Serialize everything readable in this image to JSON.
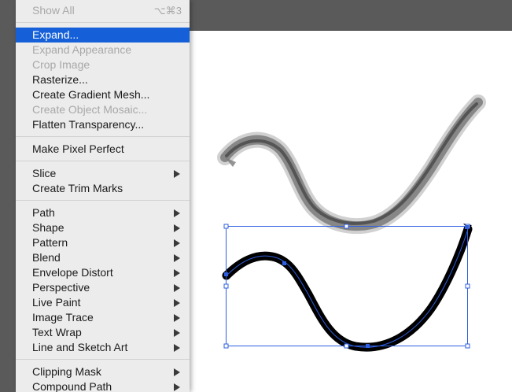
{
  "menu": {
    "items": [
      {
        "id": "show-all",
        "label": "Show All",
        "shortcut": "⌥⌘3",
        "state": "disabled",
        "submenu": false
      },
      {
        "id": "expand",
        "label": "Expand...",
        "state": "highlighted",
        "submenu": false
      },
      {
        "id": "expand-appearance",
        "label": "Expand Appearance",
        "state": "disabled",
        "submenu": false
      },
      {
        "id": "crop-image",
        "label": "Crop Image",
        "state": "disabled",
        "submenu": false
      },
      {
        "id": "rasterize",
        "label": "Rasterize...",
        "state": "enabled",
        "submenu": false
      },
      {
        "id": "create-gradient-mesh",
        "label": "Create Gradient Mesh...",
        "state": "enabled",
        "submenu": false
      },
      {
        "id": "create-object-mosaic",
        "label": "Create Object Mosaic...",
        "state": "disabled",
        "submenu": false
      },
      {
        "id": "flatten-transparency",
        "label": "Flatten Transparency...",
        "state": "enabled",
        "submenu": false
      },
      {
        "id": "make-pixel-perfect",
        "label": "Make Pixel Perfect",
        "state": "enabled",
        "submenu": false
      },
      {
        "id": "slice",
        "label": "Slice",
        "state": "enabled",
        "submenu": true
      },
      {
        "id": "create-trim-marks",
        "label": "Create Trim Marks",
        "state": "enabled",
        "submenu": false
      },
      {
        "id": "path",
        "label": "Path",
        "state": "enabled",
        "submenu": true
      },
      {
        "id": "shape",
        "label": "Shape",
        "state": "enabled",
        "submenu": true
      },
      {
        "id": "pattern",
        "label": "Pattern",
        "state": "enabled",
        "submenu": true
      },
      {
        "id": "blend",
        "label": "Blend",
        "state": "enabled",
        "submenu": true
      },
      {
        "id": "envelope-distort",
        "label": "Envelope Distort",
        "state": "enabled",
        "submenu": true
      },
      {
        "id": "perspective",
        "label": "Perspective",
        "state": "enabled",
        "submenu": true
      },
      {
        "id": "live-paint",
        "label": "Live Paint",
        "state": "enabled",
        "submenu": true
      },
      {
        "id": "image-trace",
        "label": "Image Trace",
        "state": "enabled",
        "submenu": true
      },
      {
        "id": "text-wrap",
        "label": "Text Wrap",
        "state": "enabled",
        "submenu": true
      },
      {
        "id": "line-and-sketch-art",
        "label": "Line and Sketch Art",
        "state": "enabled",
        "submenu": true
      },
      {
        "id": "clipping-mask",
        "label": "Clipping Mask",
        "state": "enabled",
        "submenu": true
      },
      {
        "id": "compound-path",
        "label": "Compound Path",
        "state": "enabled",
        "submenu": true
      }
    ],
    "separators_after": [
      "show-all",
      "flatten-transparency",
      "make-pixel-perfect",
      "create-trim-marks",
      "line-and-sketch-art"
    ]
  },
  "canvas": {
    "background": "#ffffff",
    "upper_stroke_color": "#6e6e6e",
    "lower_stroke_color": "#000000",
    "selection_color": "#2f5fe0",
    "lower_path_selected": true
  },
  "colors": {
    "highlight": "#1560d8",
    "menu_background": "#ececec",
    "workspace": "#5a5a5a"
  }
}
